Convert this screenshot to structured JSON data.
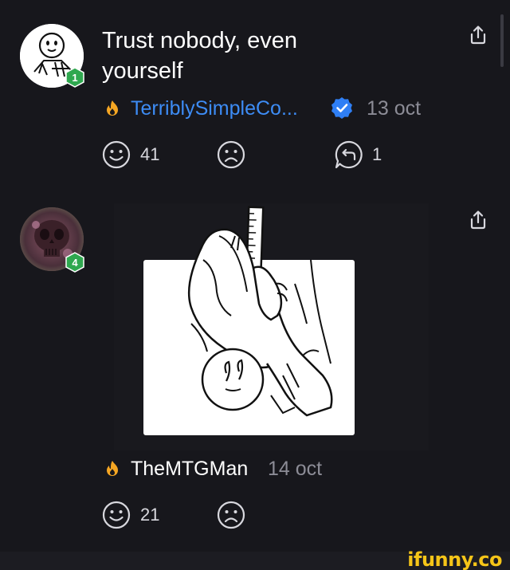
{
  "post1": {
    "title": "Trust nobody, even yourself",
    "author": "TerriblySimpleCo...",
    "date": "13 oct",
    "level": "1",
    "smile_count": "41",
    "reply_count": "1",
    "icons": {
      "avatar": "cartoon-face-avatar",
      "flame": "flame-icon",
      "verified": "verified-badge-icon",
      "share": "share-icon",
      "smile": "smile-icon",
      "frown": "frown-icon",
      "reply": "reply-icon"
    }
  },
  "post2": {
    "author": "TheMTGMan",
    "date": "14 oct",
    "level": "4",
    "smile_count": "21",
    "icons": {
      "avatar": "skull-avatar",
      "flame": "flame-icon",
      "share": "share-icon",
      "smile": "smile-icon",
      "frown": "frown-icon"
    }
  },
  "watermark": "ifunny.co",
  "colors": {
    "background": "#17171c",
    "author_link": "#3d8cf5",
    "level_badge": "#2fa84f",
    "flame": "#f5a623",
    "verified": "#2f7ff5",
    "muted_text": "#8c8c96",
    "watermark": "#f5c518"
  }
}
